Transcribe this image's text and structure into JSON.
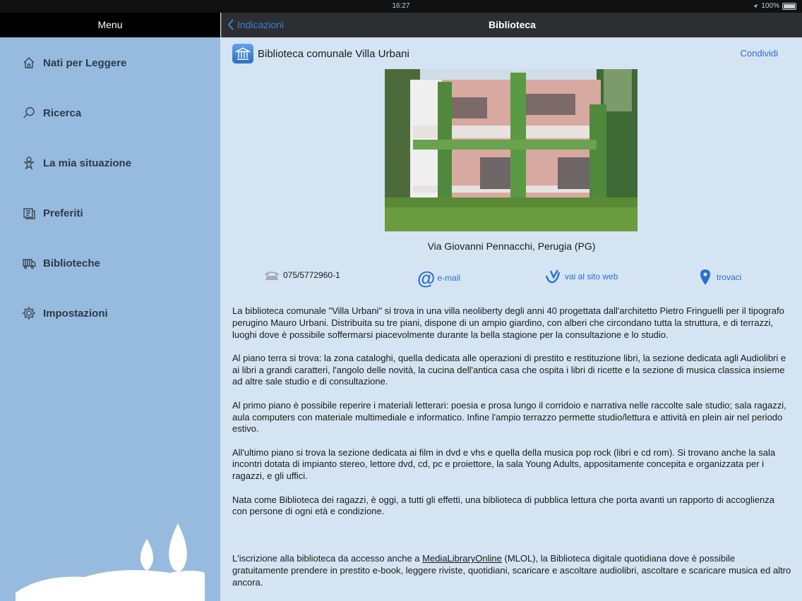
{
  "status_bar": {
    "time": "16:27",
    "battery": "100%"
  },
  "menu": {
    "title": "Menu",
    "items": [
      {
        "label": "Nati per Leggere",
        "icon": "home-icon"
      },
      {
        "label": "Ricerca",
        "icon": "search-icon"
      },
      {
        "label": "La mia situazione",
        "icon": "person-icon"
      },
      {
        "label": "Preferiti",
        "icon": "favorites-icon"
      },
      {
        "label": "Biblioteche",
        "icon": "libraries-icon"
      },
      {
        "label": "Impostazioni",
        "icon": "gear-icon"
      }
    ]
  },
  "navbar": {
    "back_label": "Indicazioni",
    "title": "Biblioteca"
  },
  "library": {
    "name": "Biblioteca comunale Villa Urbani",
    "share_label": "Condividi",
    "address": "Via Giovanni Pennacchi, Perugia (PG)",
    "phone": "075/5772960-1",
    "email_label": "e-mail",
    "web_label": "vai al sito web",
    "map_label": "trovaci"
  },
  "description": {
    "p1": "La biblioteca comunale \"Villa Urbani\" si trova in una villa neoliberty degli anni 40 progettata dall'architetto Pietro Fringuelli per il tipografo perugino Mauro Urbani. Distribuita su tre piani, dispone di un ampio giardino, con alberi che circondano tutta la struttura, e di terrazzi, luoghi dove è possibile soffermarsi piacevolmente durante la bella stagione per la consultazione e lo studio.",
    "p2": "Al piano terra si trova: la zona cataloghi, quella dedicata alle operazioni di prestito e restituzione libri, la sezione dedicata agli Audiolibri e ai libri a grandi caratteri, l'angolo delle novità, la cucina dell'antica casa che ospita i libri di ricette e la sezione di musica classica insieme ad altre sale studio e di consultazione.",
    "p3": "Al primo piano è possibile reperire i materiali letterari: poesia e prosa lungo il corridoio e narrativa nelle raccolte sale studio; sala ragazzi, aula computers con materiale multimediale e informatico. Infine l'ampio terrazzo permette studio/lettura e attività en plein air nel periodo estivo.",
    "p4": "All'ultimo piano si trova la sezione dedicata ai film in dvd e vhs e quella della musica pop rock (libri e cd rom). Si trovano anche la sala incontri dotata di impianto stereo, lettore dvd, cd, pc e proiettore, la sala Young Adults, appositamente concepita e organizzata per i ragazzi, e gli uffici.",
    "p5": "Nata come Biblioteca dei ragazzi, è oggi, a tutti gli effetti, una biblioteca di pubblica lettura che porta avanti un rapporto di accoglienza con persone di ogni età e condizione.",
    "p6_before": "L'iscrizione alla biblioteca da accesso anche a ",
    "p6_link": "MediaLibraryOnline",
    "p6_after": " (MLOL), la Biblioteca digitale quotidiana dove è possibile gratuitamente prendere in prestito e-book, leggere riviste, quotidiani, scaricare e ascoltare audiolibri, ascoltare e scaricare musica ed altro ancora."
  },
  "colors": {
    "accent": "#2a6fcd",
    "sidebar_bg": "#97bbde",
    "content_bg": "#d5e4f2",
    "navbar_bg": "#2c2e31"
  }
}
